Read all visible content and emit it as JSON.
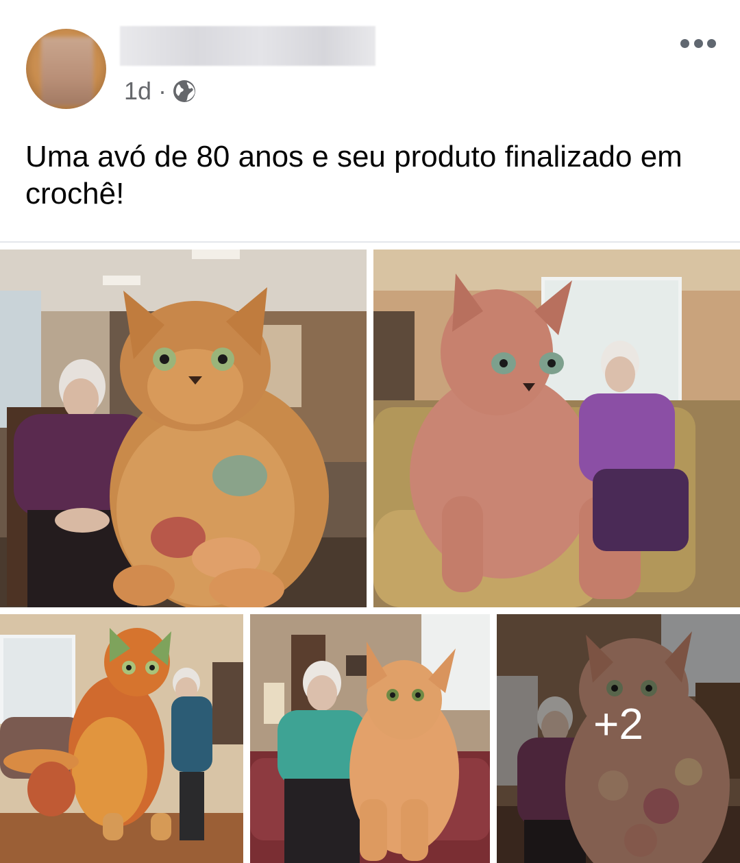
{
  "post": {
    "timestamp": "1d",
    "separator": "·",
    "privacy_icon": "globe-icon",
    "more_icon": "more-options-icon",
    "text": "Uma avó de 80 anos e seu produto finalizado em crochê!"
  },
  "gallery": {
    "extra_count": "+2",
    "photos": [
      {
        "subject": "crochet-cat-multicolor"
      },
      {
        "subject": "crochet-cat-pink"
      },
      {
        "subject": "crochet-cat-rainbow"
      },
      {
        "subject": "crochet-cat-orange"
      },
      {
        "subject": "crochet-cat-floral"
      }
    ]
  },
  "colors": {
    "text_primary": "#050505",
    "text_secondary": "#65676b",
    "divider": "#e4e6eb"
  }
}
